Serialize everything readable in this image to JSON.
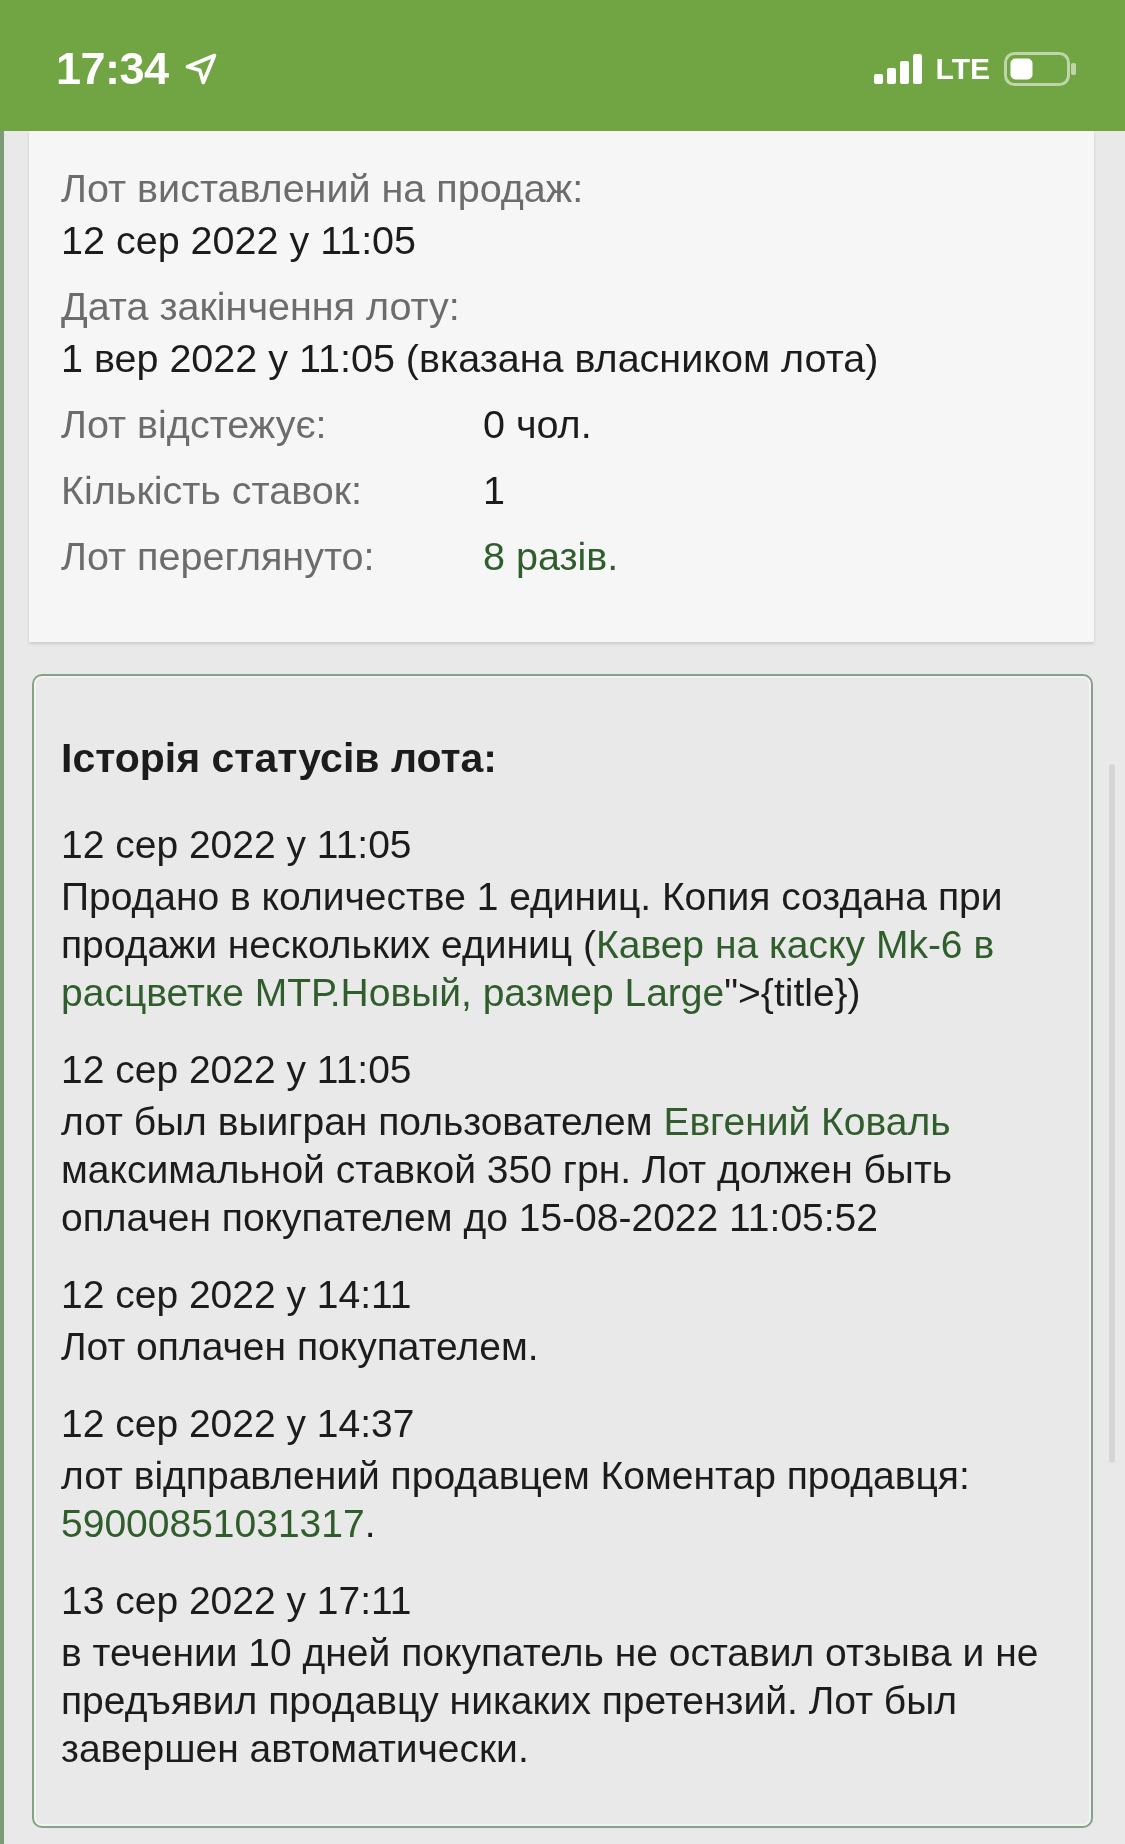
{
  "status_bar": {
    "time": "17:34",
    "network": "LTE"
  },
  "lot_details": {
    "rows": [
      {
        "kind": "stacked",
        "label": "Лот виставлений на продаж:",
        "value": "12 сер 2022 у 11:05",
        "link": false
      },
      {
        "kind": "stacked",
        "label": "Дата закінчення лоту:",
        "value": "1 вер 2022 у 11:05 (вказана власником лота)",
        "link": false
      },
      {
        "kind": "inline",
        "label": "Лот відстежує:",
        "value": "0 чол.",
        "link": false
      },
      {
        "kind": "inline",
        "label": "Кількість ставок:",
        "value": "1",
        "link": false
      },
      {
        "kind": "inline",
        "label": "Лот переглянуто:",
        "value": "8 разів.",
        "link": true
      }
    ]
  },
  "status_history": {
    "title": "Історія статусів лота:",
    "entries": [
      {
        "date": "12 сер 2022 у 11:05",
        "parts": [
          {
            "kind": "text",
            "text": "Продано в количестве 1 единиц. Копия создана при продажи нескольких единиц ("
          },
          {
            "kind": "link",
            "text": "Кавер на каску Mk-6 в расцветке МТР.Новый, размер Large"
          },
          {
            "kind": "text",
            "text": "\">{title})"
          }
        ]
      },
      {
        "date": "12 сер 2022 у 11:05",
        "parts": [
          {
            "kind": "text",
            "text": "лот был выигран пользователем "
          },
          {
            "kind": "link",
            "text": "Евгений Коваль"
          },
          {
            "kind": "text",
            "text": " максимальной ставкой 350 грн. Лот должен быть оплачен покупателем до 15-08-2022 11:05:52"
          }
        ]
      },
      {
        "date": "12 сер 2022 у 14:11",
        "parts": [
          {
            "kind": "text",
            "text": "Лот оплачен покупателем."
          }
        ]
      },
      {
        "date": "12 сер 2022 у 14:37",
        "parts": [
          {
            "kind": "text",
            "text": "лот відправлений продавцем Коментар продавця: "
          },
          {
            "kind": "link",
            "text": "59000851031317"
          },
          {
            "kind": "text",
            "text": "."
          }
        ]
      },
      {
        "date": "13 сер 2022 у 17:11",
        "parts": [
          {
            "kind": "text",
            "text": "в течении 10 дней покупатель не оставил отзыва и не предъявил продавцу никаких претензий. Лот был завершен автоматически."
          }
        ]
      }
    ]
  }
}
